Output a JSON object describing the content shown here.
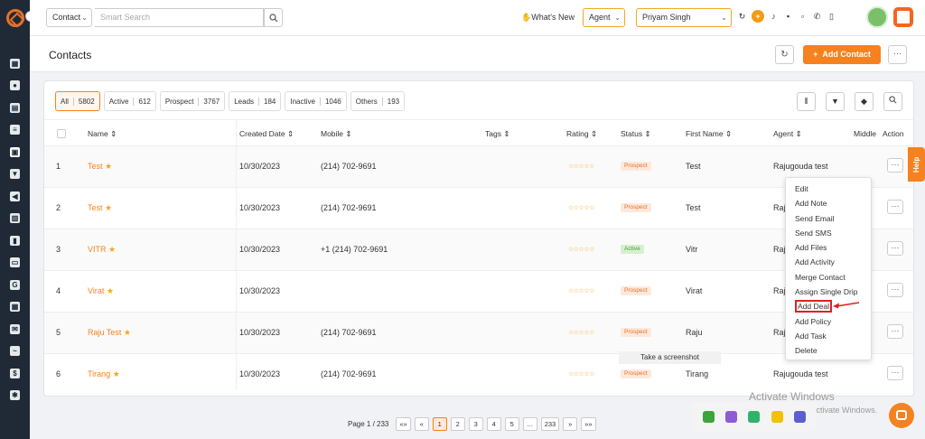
{
  "topbar": {
    "contact_select": "Contact",
    "search_placeholder": "Smart Search",
    "whats_new": "What's New",
    "agent_select": "Agent",
    "user_select": "Priyam Singh"
  },
  "header": {
    "title": "Contacts",
    "add_contact": "Add Contact",
    "add_contact_prefix": "+"
  },
  "filters": [
    {
      "label": "All",
      "count": "5802"
    },
    {
      "label": "Active",
      "count": "612"
    },
    {
      "label": "Prospect",
      "count": "3767"
    },
    {
      "label": "Leads",
      "count": "184"
    },
    {
      "label": "Inactive",
      "count": "1046"
    },
    {
      "label": "Others",
      "count": "193"
    }
  ],
  "columns": {
    "name": "Name",
    "created": "Created Date",
    "mobile": "Mobile",
    "tags": "Tags",
    "rating": "Rating",
    "status": "Status",
    "first_name": "First Name",
    "agent": "Agent",
    "middle": "Middle",
    "action": "Action",
    "sort_glyph": "⇕"
  },
  "rows": [
    {
      "num": "1",
      "name": "Test",
      "created": "10/30/2023",
      "mobile": "(214) 702-9691",
      "status": "Prospect",
      "first_name": "Test",
      "agent": "Rajugouda test"
    },
    {
      "num": "2",
      "name": "Test",
      "created": "10/30/2023",
      "mobile": "(214) 702-9691",
      "status": "Prospect",
      "first_name": "Test",
      "agent": "Raj"
    },
    {
      "num": "3",
      "name": "VITR",
      "created": "10/30/2023",
      "mobile": "+1 (214) 702-9691",
      "status": "Active",
      "first_name": "Vitr",
      "agent": "Raj"
    },
    {
      "num": "4",
      "name": "Virat",
      "created": "10/30/2023",
      "mobile": "",
      "status": "Prospect",
      "first_name": "Virat",
      "agent": "Raj"
    },
    {
      "num": "5",
      "name": "Raju Test",
      "created": "10/30/2023",
      "mobile": "(214) 702-9691",
      "status": "Prospect",
      "first_name": "Raju",
      "agent": "Raj"
    },
    {
      "num": "6",
      "name": "Tirang",
      "created": "10/30/2023",
      "mobile": "(214) 702-9691",
      "status": "Prospect",
      "first_name": "Tirang",
      "agent": "Rajugouda test"
    }
  ],
  "rating_stars": "☆☆☆☆☆",
  "menu": [
    "Edit",
    "Add Note",
    "Send Email",
    "Send SMS",
    "Add Files",
    "Add Activity",
    "Merge Contact",
    "Assign Single Drip",
    "Add Deal",
    "Add Policy",
    "Add Task",
    "Delete"
  ],
  "pagination": {
    "label": "Page 1 / 233",
    "first": "«»",
    "prev": "«",
    "pages": [
      "1",
      "2",
      "3",
      "4",
      "5",
      "...",
      "233"
    ],
    "next": "»",
    "last": "»»"
  },
  "overlay": {
    "screenshot_tip": "Take a screenshot",
    "activate_title": "Activate Windows",
    "activate_sub": "Go to Settings to activate Windows."
  },
  "help_label": "Help",
  "colors": {
    "accent": "#f5821f",
    "sidebar": "#1f2a36"
  }
}
